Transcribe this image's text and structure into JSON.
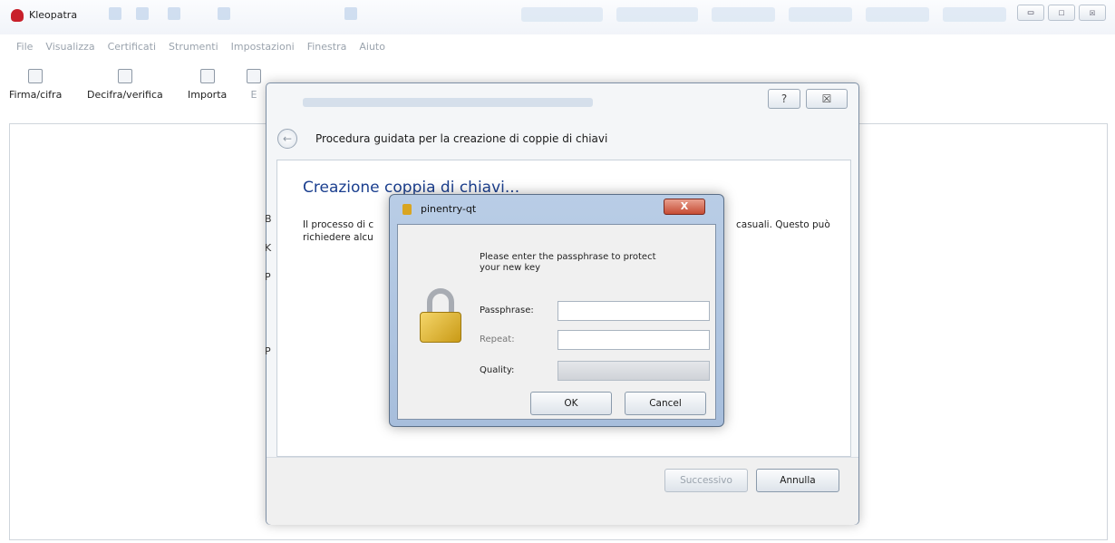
{
  "main": {
    "app_title": "Kleopatra",
    "window_controls": {
      "minimize": "▭",
      "maximize": "☐",
      "close": "☒"
    },
    "menu": [
      "File",
      "Visualizza",
      "Certificati",
      "Strumenti",
      "Impostazioni",
      "Finestra",
      "Aiuto"
    ],
    "toolbar": [
      {
        "label": "Firma/cifra",
        "icon": "sign-encrypt-icon"
      },
      {
        "label": "Decifra/verifica",
        "icon": "decrypt-verify-icon"
      },
      {
        "label": "Importa",
        "icon": "import-icon"
      },
      {
        "label": "E",
        "icon": "export-icon"
      }
    ]
  },
  "wizard": {
    "help_label": "?",
    "close_label": "☒",
    "back_label": "←",
    "title": "Procedura guidata per la creazione di coppie di chiavi",
    "heading": "Creazione coppia di chiavi...",
    "body_line1": "Il processo di c",
    "body_line2": "richiedere alcu",
    "body_right": "casuali. Questo può",
    "side_letters": [
      "B",
      "K",
      "P",
      "P"
    ],
    "next_label": "Successivo",
    "cancel_label": "Annulla"
  },
  "pinentry": {
    "title": "pinentry-qt",
    "close_label": "X",
    "description": "Please enter the passphrase to protect your new key",
    "passphrase_label": "Passphrase:",
    "repeat_label": "Repeat:",
    "quality_label": "Quality:",
    "quality_value": 0,
    "ok_label": "OK",
    "cancel_label": "Cancel"
  },
  "colors": {
    "heading": "#1b3f8f",
    "close_button": "#c64c34",
    "lock": "#d9a521"
  }
}
